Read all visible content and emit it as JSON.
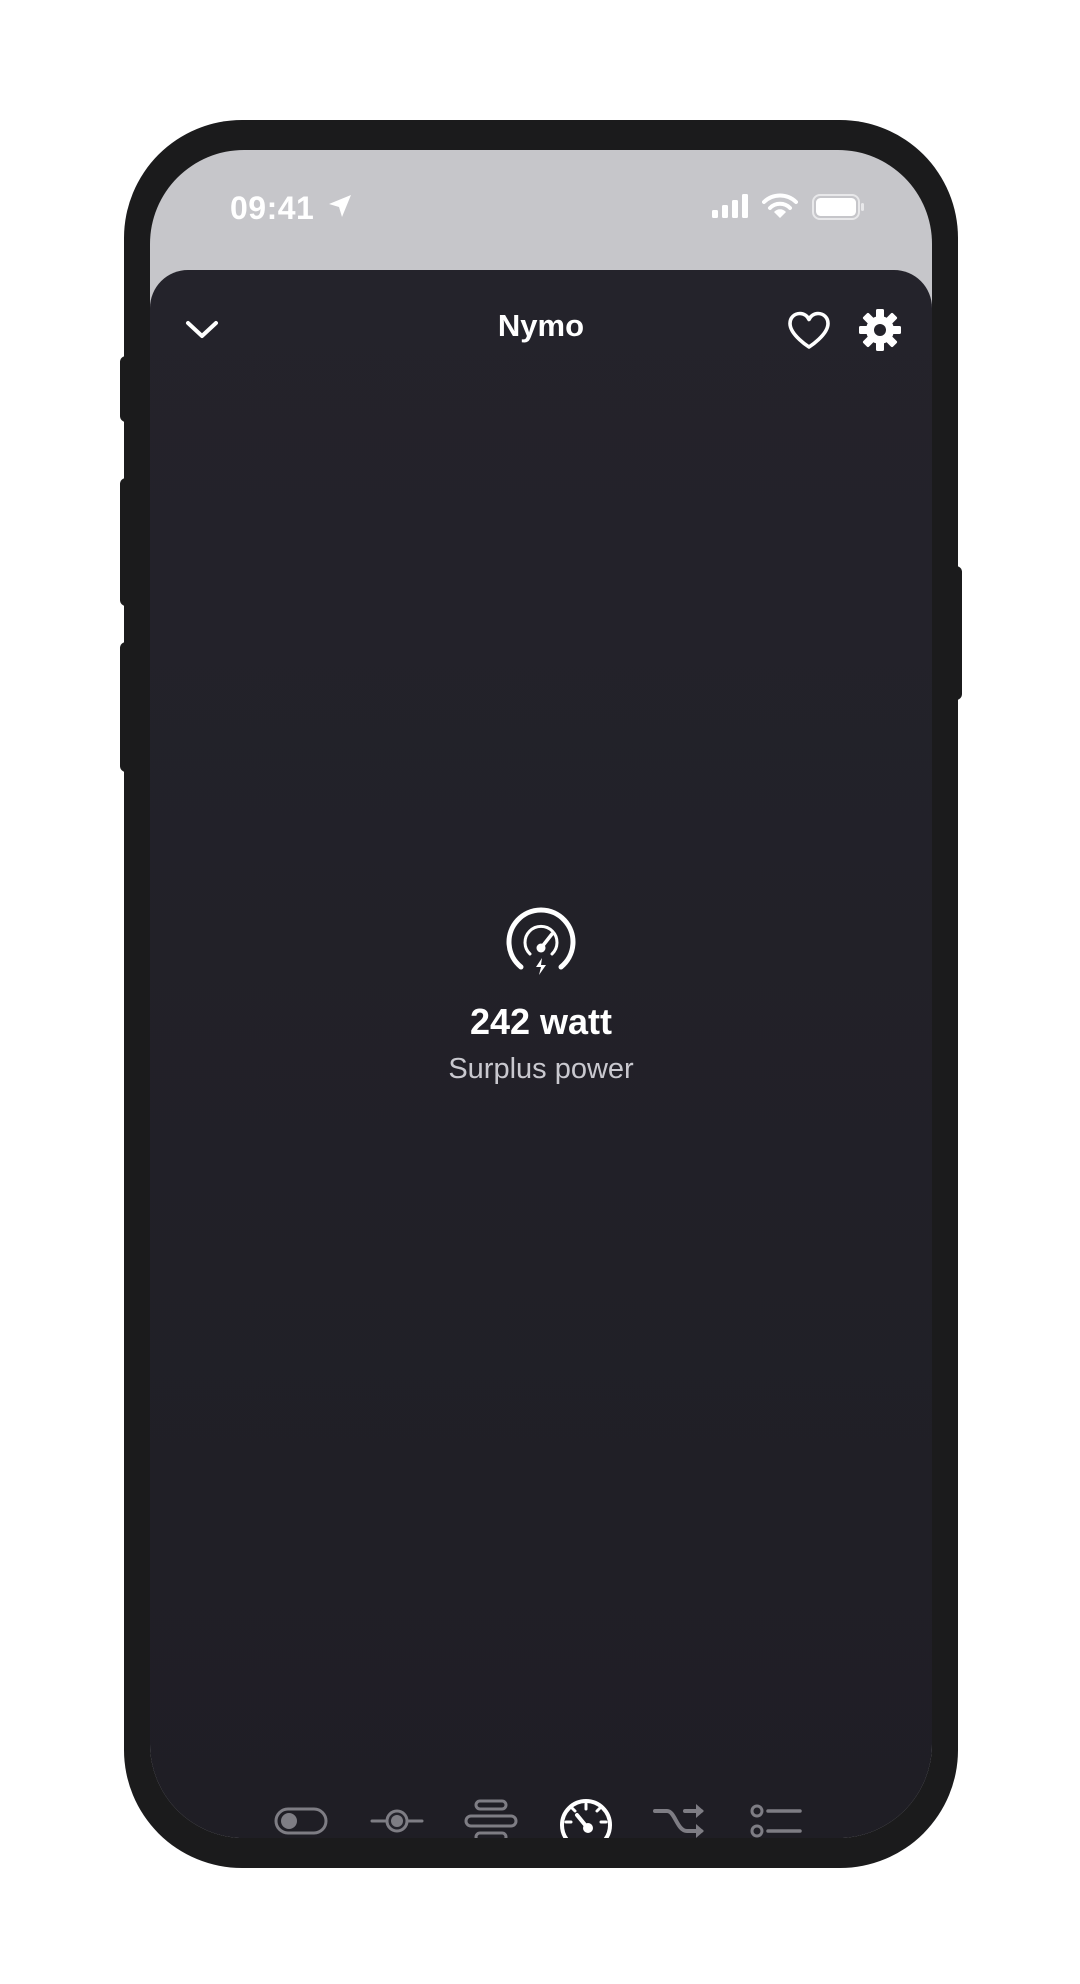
{
  "status_bar": {
    "time": "09:41",
    "icons": [
      "location-arrow-icon",
      "cellular-signal-icon",
      "wifi-icon",
      "battery-icon"
    ]
  },
  "header": {
    "title": "Nymo",
    "left_icon": "chevron-down-icon",
    "right_icons": [
      "heart-icon",
      "gear-icon"
    ]
  },
  "main": {
    "icon": "power-gauge-icon",
    "value": "242 watt",
    "label": "Surplus power"
  },
  "tab_bar": {
    "tabs": [
      {
        "icon": "toggle-icon",
        "active": false
      },
      {
        "icon": "slider-icon",
        "active": false
      },
      {
        "icon": "stacked-bars-icon",
        "active": false
      },
      {
        "icon": "gauge-icon",
        "active": true
      },
      {
        "icon": "shuffle-icon",
        "active": false
      },
      {
        "icon": "list-icon",
        "active": false
      }
    ]
  },
  "colors": {
    "background": "#ffffff",
    "phone_frame": "#1b1b1c",
    "status_area": "#c6c6ca",
    "sheet": "#222129",
    "text_primary": "#ffffff",
    "text_secondary": "#c9c8cf",
    "icon_inactive": "#7e7d84",
    "icon_active": "#ffffff"
  }
}
